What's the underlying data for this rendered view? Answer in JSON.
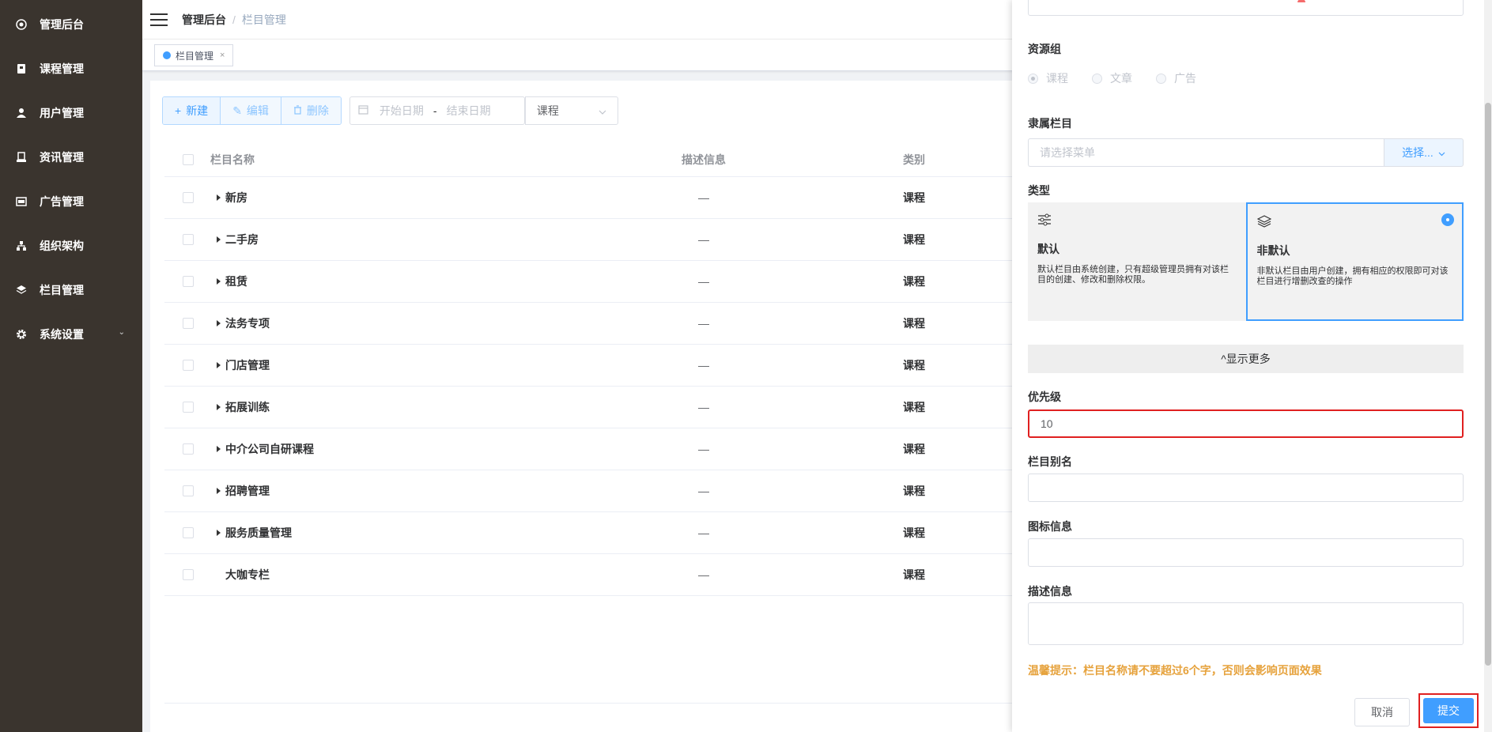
{
  "sidebar": {
    "items": [
      {
        "label": "管理后台"
      },
      {
        "label": "课程管理"
      },
      {
        "label": "用户管理"
      },
      {
        "label": "资讯管理"
      },
      {
        "label": "广告管理"
      },
      {
        "label": "组织架构"
      },
      {
        "label": "栏目管理"
      },
      {
        "label": "系统设置"
      }
    ]
  },
  "breadcrumb": {
    "home": "管理后台",
    "separator": "/",
    "current": "栏目管理"
  },
  "tabs": [
    {
      "label": "栏目管理",
      "close": "×"
    }
  ],
  "toolbar": {
    "new_label": "新建",
    "edit_label": "编辑",
    "delete_label": "删除",
    "start_placeholder": "开始日期",
    "range_separator": "-",
    "end_placeholder": "结束日期",
    "type_select": "课程"
  },
  "table": {
    "headers": {
      "name": "栏目名称",
      "desc": "描述信息",
      "category": "类别"
    },
    "rows": [
      {
        "name": "新房",
        "desc": "—",
        "category": "课程"
      },
      {
        "name": "二手房",
        "desc": "—",
        "category": "课程"
      },
      {
        "name": "租赁",
        "desc": "—",
        "category": "课程"
      },
      {
        "name": "法务专项",
        "desc": "—",
        "category": "课程"
      },
      {
        "name": "门店管理",
        "desc": "—",
        "category": "课程"
      },
      {
        "name": "拓展训练",
        "desc": "—",
        "category": "课程"
      },
      {
        "name": "中介公司自研课程",
        "desc": "—",
        "category": "课程"
      },
      {
        "name": "招聘管理",
        "desc": "—",
        "category": "课程"
      },
      {
        "name": "服务质量管理",
        "desc": "—",
        "category": "课程"
      },
      {
        "name": "大咖专栏",
        "desc": "—",
        "category": "课程"
      }
    ]
  },
  "drawer": {
    "resource_group": {
      "label": "资源组",
      "options": [
        "课程",
        "文章",
        "广告"
      ],
      "selected": "课程"
    },
    "parent": {
      "label": "隶属栏目",
      "placeholder": "请选择菜单",
      "button": "选择..."
    },
    "type": {
      "label": "类型",
      "cards": [
        {
          "title": "默认",
          "text": "默认栏目由系统创建，只有超级管理员拥有对该栏目的创建、修改和删除权限。"
        },
        {
          "title": "非默认",
          "text": "非默认栏目由用户创建，拥有相应的权限即可对该栏目进行增删改查的操作"
        }
      ],
      "selected": "非默认"
    },
    "show_more": "^显示更多",
    "priority": {
      "label": "优先级",
      "value": "10"
    },
    "alias": {
      "label": "栏目别名",
      "value": ""
    },
    "icon_info": {
      "label": "图标信息",
      "value": ""
    },
    "description": {
      "label": "描述信息",
      "value": ""
    },
    "tip": "温馨提示：栏目名称请不要超过6个字，否则会影响页面效果",
    "cancel": "取消",
    "submit": "提交"
  }
}
